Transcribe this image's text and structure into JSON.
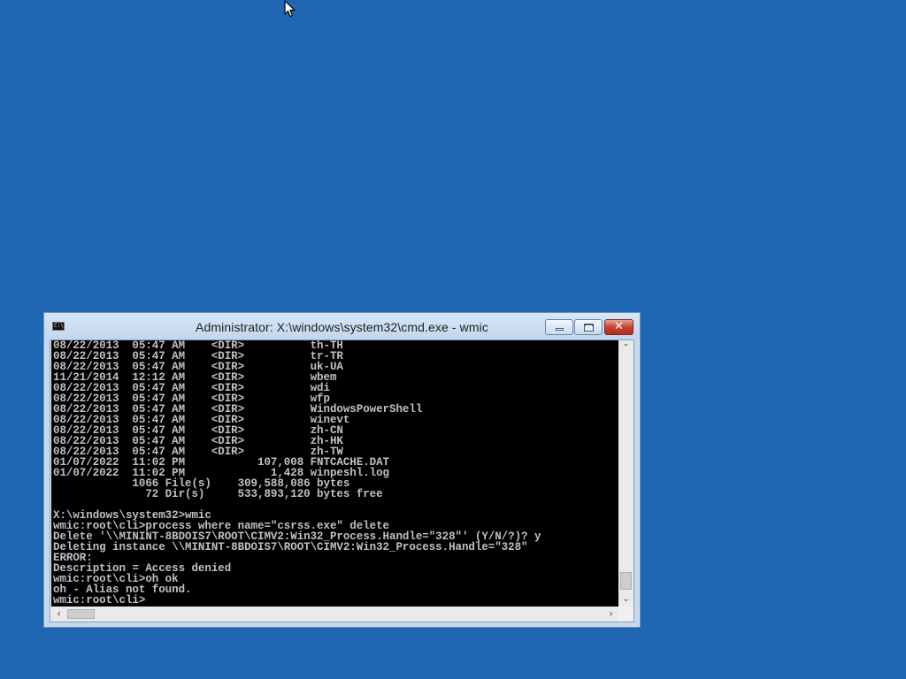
{
  "window": {
    "title": "Administrator: X:\\windows\\system32\\cmd.exe - wmic",
    "icon_label": "C:\\",
    "minimize_icon": "minimize-icon",
    "maximize_icon": "maximize-icon",
    "close_icon": "close-icon",
    "close_glyph": "✕"
  },
  "console": {
    "lines": [
      "08/22/2013  05:47 AM    <DIR>          th-TH",
      "08/22/2013  05:47 AM    <DIR>          tr-TR",
      "08/22/2013  05:47 AM    <DIR>          uk-UA",
      "11/21/2014  12:12 AM    <DIR>          wbem",
      "08/22/2013  05:47 AM    <DIR>          wdi",
      "08/22/2013  05:47 AM    <DIR>          wfp",
      "08/22/2013  05:47 AM    <DIR>          WindowsPowerShell",
      "08/22/2013  05:47 AM    <DIR>          winevt",
      "08/22/2013  05:47 AM    <DIR>          zh-CN",
      "08/22/2013  05:47 AM    <DIR>          zh-HK",
      "08/22/2013  05:47 AM    <DIR>          zh-TW",
      "01/07/2022  11:02 PM           107,008 FNTCACHE.DAT",
      "01/07/2022  11:02 PM             1,428 winpeshl.log",
      "            1066 File(s)    309,588,086 bytes",
      "              72 Dir(s)     533,893,120 bytes free",
      "",
      "X:\\windows\\system32>wmic",
      "wmic:root\\cli>process where name=\"csrss.exe\" delete",
      "Delete '\\\\MININT-8BDOIS7\\ROOT\\CIMV2:Win32_Process.Handle=\"328\"' (Y/N/?)? y",
      "Deleting instance \\\\MININT-8BDOIS7\\ROOT\\CIMV2:Win32_Process.Handle=\"328\"",
      "ERROR:",
      "Description = Access denied",
      "wmic:root\\cli>oh ok",
      "oh - Alias not found.",
      "wmic:root\\cli>"
    ]
  },
  "scrollbars": {
    "up_glyph": "⌃",
    "down_glyph": "⌄",
    "left_glyph": "‹",
    "right_glyph": "›"
  }
}
